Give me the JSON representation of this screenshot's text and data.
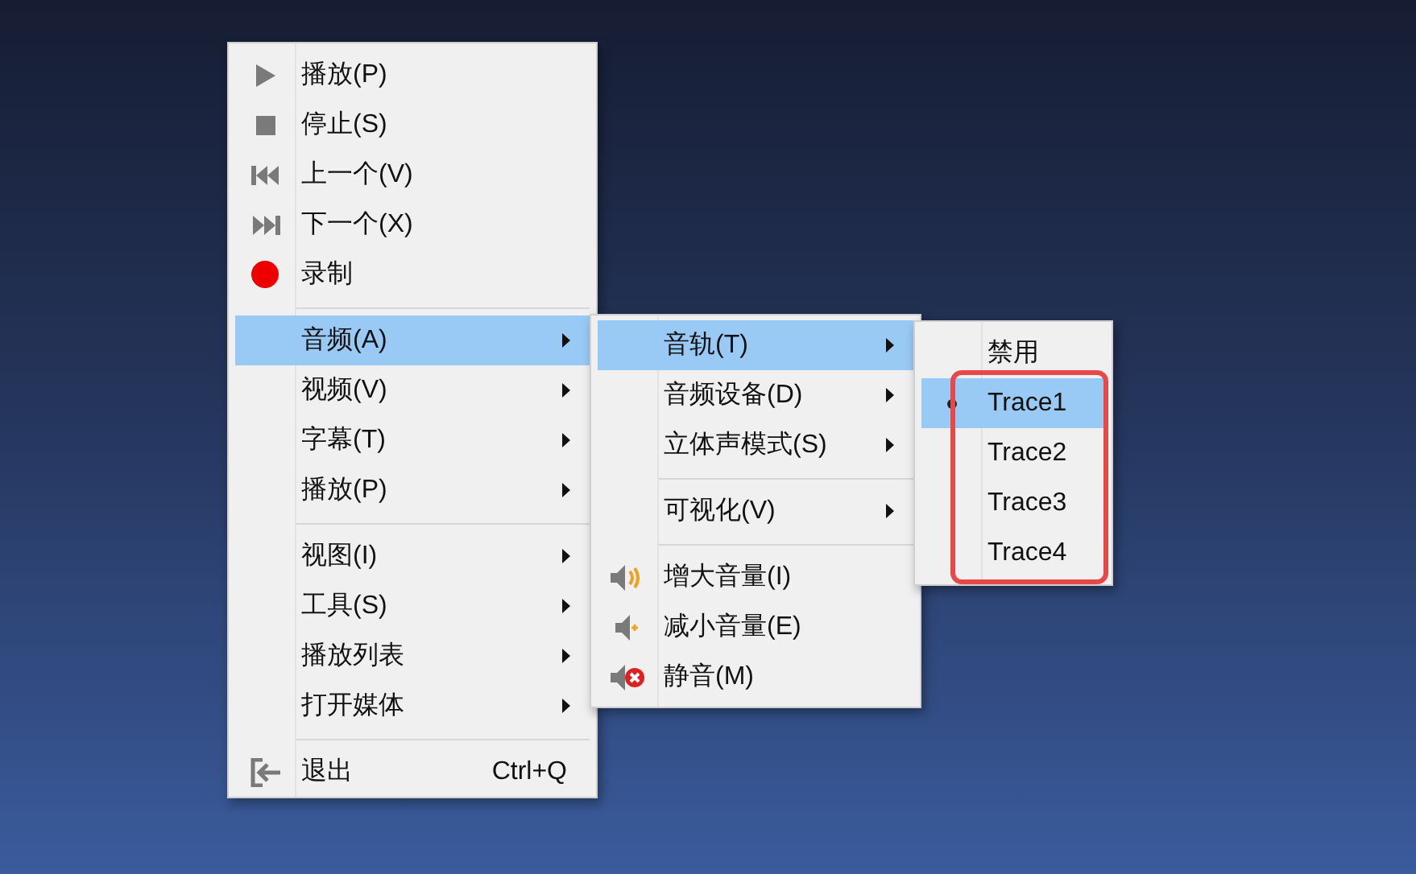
{
  "menus": [
    {
      "items": [
        {
          "kind": "item",
          "label": "播放(P)",
          "has_submenu": false,
          "selected": false
        },
        {
          "kind": "item",
          "label": "停止(S)",
          "has_submenu": false,
          "selected": false
        },
        {
          "kind": "item",
          "label": "上一个(V)",
          "has_submenu": false,
          "selected": false
        },
        {
          "kind": "item",
          "label": "下一个(X)",
          "has_submenu": false,
          "selected": false
        },
        {
          "kind": "item",
          "label": "录制",
          "has_submenu": false,
          "selected": false
        },
        {
          "kind": "separator"
        },
        {
          "kind": "item",
          "label": "音频(A)",
          "has_submenu": true,
          "selected": true
        },
        {
          "kind": "item",
          "label": "视频(V)",
          "has_submenu": true,
          "selected": false
        },
        {
          "kind": "item",
          "label": "字幕(T)",
          "has_submenu": true,
          "selected": false
        },
        {
          "kind": "item",
          "label": "播放(P)",
          "has_submenu": true,
          "selected": false
        },
        {
          "kind": "separator"
        },
        {
          "kind": "item",
          "label": "视图(I)",
          "has_submenu": true,
          "selected": false
        },
        {
          "kind": "item",
          "label": "工具(S)",
          "has_submenu": true,
          "selected": false
        },
        {
          "kind": "item",
          "label": "播放列表",
          "has_submenu": true,
          "selected": false
        },
        {
          "kind": "item",
          "label": "打开媒体",
          "has_submenu": true,
          "selected": false
        },
        {
          "kind": "separator"
        },
        {
          "kind": "item",
          "label": "退出",
          "shortcut": "Ctrl+Q",
          "has_submenu": false,
          "selected": false
        }
      ]
    },
    {
      "items": [
        {
          "kind": "item",
          "label": "音轨(T)",
          "has_submenu": true,
          "selected": true
        },
        {
          "kind": "item",
          "label": "音频设备(D)",
          "has_submenu": true,
          "selected": false
        },
        {
          "kind": "item",
          "label": "立体声模式(S)",
          "has_submenu": true,
          "selected": false
        },
        {
          "kind": "separator"
        },
        {
          "kind": "item",
          "label": "可视化(V)",
          "has_submenu": true,
          "selected": false
        },
        {
          "kind": "separator"
        },
        {
          "kind": "item",
          "label": "增大音量(I)",
          "has_submenu": false,
          "selected": false
        },
        {
          "kind": "item",
          "label": "减小音量(E)",
          "has_submenu": false,
          "selected": false
        },
        {
          "kind": "item",
          "label": "静音(M)",
          "has_submenu": false,
          "selected": false
        }
      ]
    },
    {
      "items": [
        {
          "kind": "item",
          "label": "禁用",
          "has_submenu": false,
          "selected": false,
          "checked": false
        },
        {
          "kind": "item",
          "label": "Trace1",
          "has_submenu": false,
          "selected": true,
          "checked": true
        },
        {
          "kind": "item",
          "label": "Trace2",
          "has_submenu": false,
          "selected": false,
          "checked": false
        },
        {
          "kind": "item",
          "label": "Trace3",
          "has_submenu": false,
          "selected": false,
          "checked": false
        },
        {
          "kind": "item",
          "label": "Trace4",
          "has_submenu": false,
          "selected": false,
          "checked": false
        }
      ]
    }
  ]
}
